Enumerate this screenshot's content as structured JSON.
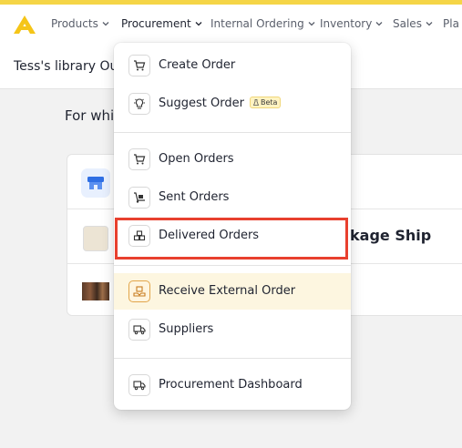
{
  "nav": {
    "items": [
      {
        "label": "Products"
      },
      {
        "label": "Procurement"
      },
      {
        "label": "Internal Ordering"
      },
      {
        "label": "Inventory"
      },
      {
        "label": "Sales"
      },
      {
        "label": "Pla"
      }
    ]
  },
  "subheader": {
    "title": "Tess's library Ou"
  },
  "content": {
    "question": "For whi",
    "row2_title": "kage Ship"
  },
  "menu": {
    "items": [
      {
        "label": "Create Order",
        "icon": "cart-plus-icon"
      },
      {
        "label": "Suggest Order",
        "icon": "lightbulb-icon",
        "badge": "Beta"
      },
      {
        "label": "Open Orders",
        "icon": "cart-icon"
      },
      {
        "label": "Sent Orders",
        "icon": "dolly-icon"
      },
      {
        "label": "Delivered Orders",
        "icon": "boxes-icon"
      },
      {
        "label": "Receive External Order",
        "icon": "receive-box-icon"
      },
      {
        "label": "Suppliers",
        "icon": "truck-icon"
      },
      {
        "label": "Procurement Dashboard",
        "icon": "dashboard-truck-icon"
      }
    ]
  },
  "colors": {
    "accent": "#f5d547",
    "highlight": "#fdf6e0",
    "annotation": "#e8402e"
  }
}
